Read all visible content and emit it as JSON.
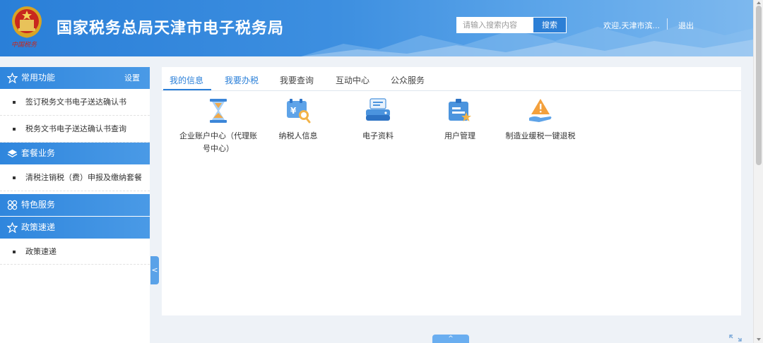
{
  "header": {
    "title": "国家税务总局天津市电子税务局",
    "emblem_text": "中国税务",
    "search_placeholder": "请输入搜索内容",
    "search_button": "搜索",
    "welcome": "欢迎,天津市滨...",
    "logout": "退出"
  },
  "sidebar": {
    "sections": [
      {
        "title": "常用功能",
        "right": "设置",
        "icon": "star-icon",
        "items": [
          "签订税务文书电子送达确认书",
          "税务文书电子送达确认书查询"
        ]
      },
      {
        "title": "套餐业务",
        "icon": "layers-icon",
        "items": [
          "清税注销税（费）申报及缴纳套餐"
        ]
      },
      {
        "title": "特色服务",
        "icon": "grid-circles-icon",
        "items": []
      },
      {
        "title": "政策速递",
        "icon": "star-icon",
        "items": [
          "政策速递"
        ]
      }
    ],
    "collapse_glyph": "<"
  },
  "tabs": [
    {
      "label": "我的信息",
      "active": true
    },
    {
      "label": "我要办税",
      "active": false
    },
    {
      "label": "我要查询",
      "active": false
    },
    {
      "label": "互动中心",
      "active": false
    },
    {
      "label": "公众服务",
      "active": false
    }
  ],
  "tiles": [
    {
      "label": "企业账户中心（代理账号中心）",
      "icon": "hourglass-icon"
    },
    {
      "label": "纳税人信息",
      "icon": "taxpayer-info-icon"
    },
    {
      "label": "电子资料",
      "icon": "scanner-icon"
    },
    {
      "label": "用户管理",
      "icon": "user-manage-icon"
    },
    {
      "label": "制造业缓税一键退税",
      "icon": "warning-hand-icon"
    }
  ],
  "bottom_tab_glyph": "^",
  "colors": {
    "accent": "#2a7fd8",
    "header_start": "#2a7fd8",
    "sidebar_head": "#3a8fe2"
  }
}
